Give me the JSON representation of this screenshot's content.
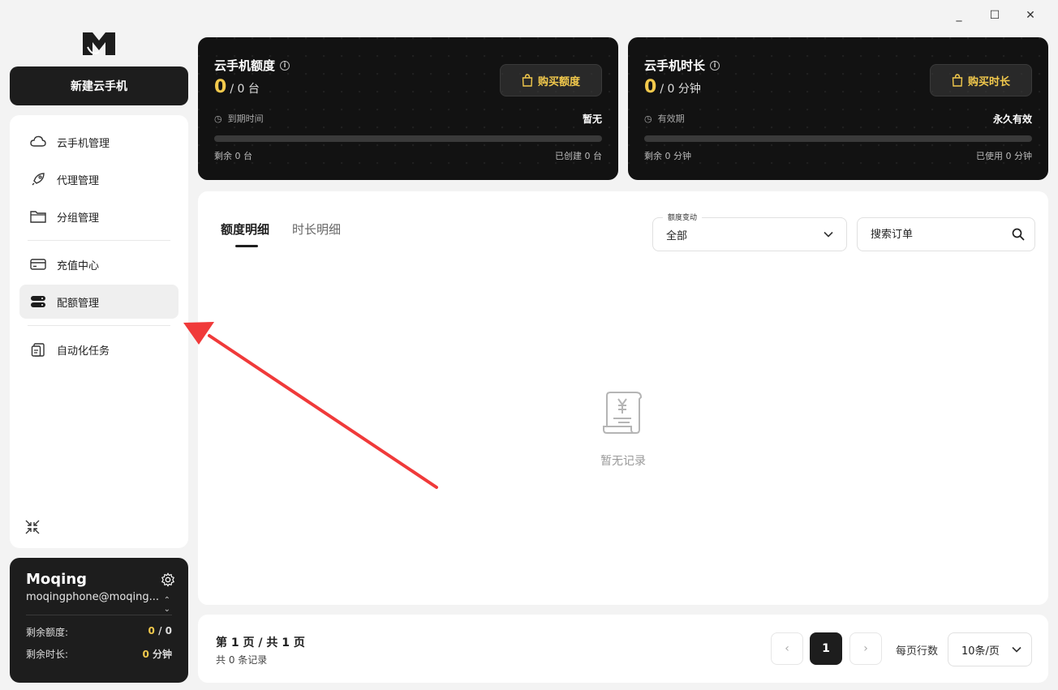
{
  "window": {
    "minimize": "_",
    "maximize": "☐",
    "close": "✕"
  },
  "sidebar": {
    "new_button": "新建云手机",
    "items": [
      {
        "label": "云手机管理",
        "icon": "cloud-icon"
      },
      {
        "label": "代理管理",
        "icon": "rocket-icon"
      },
      {
        "label": "分组管理",
        "icon": "folder-icon"
      },
      {
        "label": "充值中心",
        "icon": "card-icon"
      },
      {
        "label": "配额管理",
        "icon": "server-icon",
        "active": true
      },
      {
        "label": "自动化任务",
        "icon": "clipboard-icon"
      }
    ]
  },
  "user": {
    "name": "Moqing",
    "email": "moqingphone@moqing....",
    "remaining_quota_label": "剩余额度:",
    "remaining_quota_used": "0",
    "remaining_quota_total": " / 0",
    "remaining_time_label": "剩余时长:",
    "remaining_time_value": "0",
    "remaining_time_unit": " 分钟"
  },
  "quota_card": {
    "title": "云手机额度",
    "info": "i",
    "value": "0",
    "suffix": "/ 0 台",
    "buy_button": "购买额度",
    "expire_label": "到期时间",
    "expire_value": "暂无",
    "progress": 0,
    "remaining": "剩余 0 台",
    "created": "已创建 0 台"
  },
  "time_card": {
    "title": "云手机时长",
    "info": "i",
    "value": "0",
    "suffix": "/ 0 分钟",
    "buy_button": "购买时长",
    "valid_label": "有效期",
    "valid_value": "永久有效",
    "progress": 0,
    "remaining": "剩余 0 分钟",
    "used": "已使用 0 分钟"
  },
  "main": {
    "tabs": [
      {
        "label": "额度明细",
        "active": true
      },
      {
        "label": "时长明细"
      }
    ],
    "filter_label": "额度变动",
    "filter_value": "全部",
    "search_placeholder": "搜索订单",
    "empty_text": "暂无记录"
  },
  "pager": {
    "page_info": "第 1 页 / 共 1 页",
    "count": "共 0 条记录",
    "prev": "‹",
    "current": "1",
    "next": "›",
    "per_page_label": "每页行数",
    "per_page_value": "10条/页"
  },
  "colors": {
    "accent": "#f2c94c",
    "dark": "#1d1d1d",
    "annotation": "#f03a3a"
  }
}
